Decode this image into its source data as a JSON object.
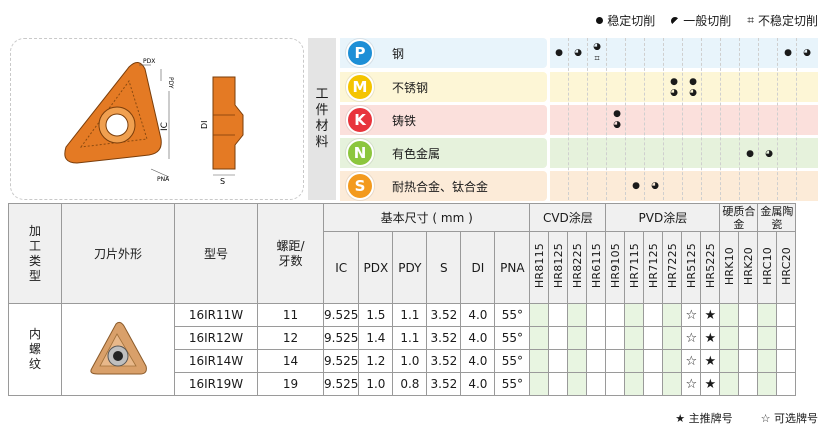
{
  "legend_top": {
    "stable": "稳定切削",
    "general": "一般切削",
    "unstable": "不稳定切削"
  },
  "workpiece_label": "工件材料",
  "drawing_labels": {
    "pdx": "PDX",
    "pdy": "PDY",
    "ic": "IC",
    "di": "DI",
    "s": "S",
    "pna": "PNA"
  },
  "materials": [
    {
      "letter": "P",
      "name": "钢",
      "color": "#1e8fd6",
      "row_bg": "#e8f4fb"
    },
    {
      "letter": "M",
      "name": "不锈钢",
      "color": "#f4c400",
      "row_bg": "#fdf6d6"
    },
    {
      "letter": "K",
      "name": "铸铁",
      "color": "#e8343c",
      "row_bg": "#fbe0dc"
    },
    {
      "letter": "N",
      "name": "有色金属",
      "color": "#8cc63e",
      "row_bg": "#e6f2dc"
    },
    {
      "letter": "S",
      "name": "耐热合金、钛合金",
      "color": "#f39a1e",
      "row_bg": "#fcebd8"
    }
  ],
  "table": {
    "headers": {
      "process_type": "加工类型",
      "insert_shape": "刀片外形",
      "model": "型号",
      "pitch": "螺距/牙数",
      "basic_size": "基本尺寸 ( mm )",
      "dims": [
        "IC",
        "PDX",
        "PDY",
        "S",
        "DI",
        "PNA"
      ],
      "cvd": "CVD涂层",
      "pvd": "PVD涂层",
      "cemented": "硬质合金",
      "cermet": "金属陶瓷",
      "grades": [
        "HR8115",
        "HR8125",
        "HR8225",
        "HR6115",
        "HR9105",
        "HR7115",
        "HR7125",
        "HR7225",
        "HR5125",
        "HR5225",
        "HRK10",
        "HRK20",
        "HRC10",
        "HRC20"
      ]
    },
    "process_value": "内螺纹",
    "rows": [
      {
        "model": "16IR11W",
        "pitch": "11",
        "ic": "9.525",
        "pdx": "1.5",
        "pdy": "1.1",
        "s": "3.52",
        "di": "4.0",
        "pna": "55°",
        "opt": "☆",
        "main": "★"
      },
      {
        "model": "16IR12W",
        "pitch": "12",
        "ic": "9.525",
        "pdx": "1.4",
        "pdy": "1.1",
        "s": "3.52",
        "di": "4.0",
        "pna": "55°",
        "opt": "☆",
        "main": "★"
      },
      {
        "model": "16IR14W",
        "pitch": "14",
        "ic": "9.525",
        "pdx": "1.2",
        "pdy": "1.0",
        "s": "3.52",
        "di": "4.0",
        "pna": "55°",
        "opt": "☆",
        "main": "★"
      },
      {
        "model": "16IR19W",
        "pitch": "19",
        "ic": "9.525",
        "pdx": "1.0",
        "pdy": "0.8",
        "s": "3.52",
        "di": "4.0",
        "pna": "55°",
        "opt": "☆",
        "main": "★"
      }
    ]
  },
  "legend_bottom": {
    "main": "★ 主推牌号",
    "optional": "☆ 可选牌号"
  }
}
